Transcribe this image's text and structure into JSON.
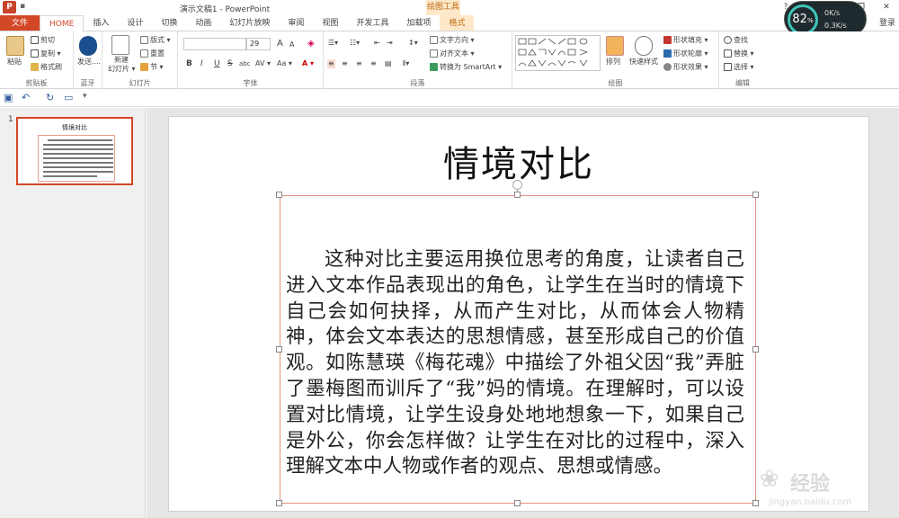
{
  "app": {
    "window_title": "演示文稿1 - PowerPoint",
    "logo": "P",
    "context_band": "绘图工具",
    "window_buttons": [
      "?",
      "▭",
      "—",
      "❐",
      "✕"
    ],
    "sign_in": "登录"
  },
  "tabs": [
    {
      "label": "文件"
    },
    {
      "label": "HOME"
    },
    {
      "label": "插入"
    },
    {
      "label": "设计"
    },
    {
      "label": "切换"
    },
    {
      "label": "动画"
    },
    {
      "label": "幻灯片放映"
    },
    {
      "label": "审阅"
    },
    {
      "label": "视图"
    },
    {
      "label": "开发工具"
    },
    {
      "label": "加载项"
    },
    {
      "label": "格式"
    }
  ],
  "ribbon": {
    "clipboard": {
      "paste": "粘贴",
      "cut": "剪切",
      "copy": "复制 ▾",
      "format_painter": "格式刷",
      "group": "剪贴板"
    },
    "bluetooth": {
      "send": "发送....",
      "group": "蓝牙"
    },
    "slides": {
      "new": "新建",
      "new2": "幻灯片 ▾",
      "layout": "版式 ▾",
      "reset": "重置",
      "section": "节 ▾",
      "group": "幻灯片"
    },
    "font": {
      "font_value": "",
      "size_value": "29",
      "bold": "B",
      "italic": "I",
      "underline": "U",
      "strike": "S",
      "shadow": "abc",
      "spacing": "AV ▾",
      "case": "Aa ▾",
      "color": "A ▾",
      "grow": "A",
      "shrink": "A",
      "clear": "◈",
      "group": "字体"
    },
    "paragraph": {
      "text_dir": "文字方向 ▾",
      "align_text": "对齐文本 ▾",
      "smartart": "转换为 SmartArt ▾",
      "group": "段落"
    },
    "drawing": {
      "arrange": "排列",
      "quick_styles": "快速样式",
      "fill": "形状填充 ▾",
      "outline": "形状轮廓 ▾",
      "effects": "形状效果 ▾",
      "group": "绘图"
    },
    "editing": {
      "find": "查找",
      "replace": "替换 ▾",
      "select": "选择 ▾",
      "group": "编辑"
    }
  },
  "perf": {
    "percent": "82",
    "unit": "%",
    "up": "0K/s",
    "down": "0.3K/s"
  },
  "thumbnail": {
    "number": "1",
    "title": "情境对比"
  },
  "slide": {
    "title": "情境对比",
    "body": "这种对比主要运用换位思考的角度，让读者自己进入文本作品表现出的角色，让学生在当时的情境下自己会如何抉择，从而产生对比，从而体会人物精神，体会文本表达的思想情感，甚至形成自己的价值观。如陈慧瑛《梅花魂》中描绘了外祖父因“我”弄脏了墨梅图而训斥了“我”妈的情境。在理解时，可以设置对比情境，让学生设身处地地想象一下，如果自己是外公，你会怎样做？让学生在对比的过程中，深入理解文本中人物或作者的观点、思想或情感。"
  },
  "watermark": {
    "cn": "经验",
    "en": "jingyan.baidu.com"
  },
  "colors": {
    "accent": "#d24726",
    "context": "#fde9c9",
    "selection": "#e0957a"
  }
}
